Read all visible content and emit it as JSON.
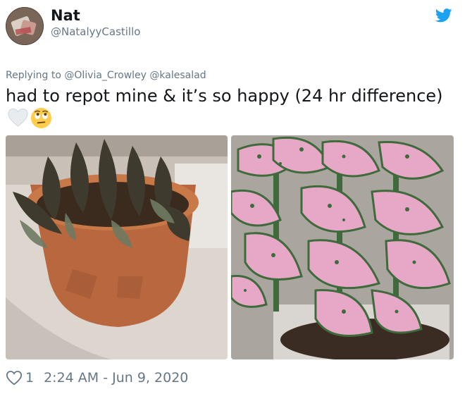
{
  "user": {
    "display_name": "Nat",
    "handle": "@NatalyyCastillo"
  },
  "reply_context": "Replying to @Olivia_Crowley @kalesalad",
  "tweet": {
    "text": "had to repot mine & it’s so happy (24 hr difference)",
    "emojis": [
      "white-heart",
      "face-with-rolling-eyes"
    ]
  },
  "media": [
    {
      "name": "wilted plant in terracotta pot"
    },
    {
      "name": "healthy pink polka dot plant"
    }
  ],
  "footer": {
    "like_count": "1",
    "timestamp": "2:24 AM - Jun 9, 2020"
  },
  "colors": {
    "text_primary": "#14171a",
    "text_secondary": "#657786",
    "twitter_blue": "#1da1f2"
  }
}
